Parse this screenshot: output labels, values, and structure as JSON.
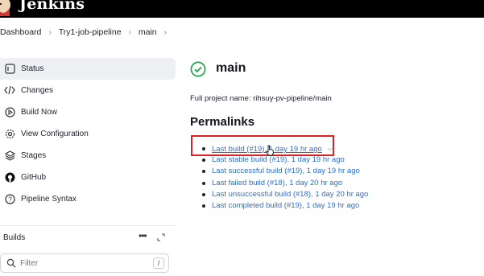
{
  "header": {
    "brand": "Jenkins"
  },
  "breadcrumb": [
    {
      "label": "Dashboard"
    },
    {
      "label": "Try1-job-pipeline"
    },
    {
      "label": "main"
    }
  ],
  "sidebar": {
    "items": [
      {
        "label": "Status",
        "icon": "status-icon",
        "active": true
      },
      {
        "label": "Changes",
        "icon": "code-icon"
      },
      {
        "label": "Build Now",
        "icon": "play-icon"
      },
      {
        "label": "View Configuration",
        "icon": "gear-icon"
      },
      {
        "label": "Stages",
        "icon": "stack-icon"
      },
      {
        "label": "GitHub",
        "icon": "github-icon"
      },
      {
        "label": "Pipeline Syntax",
        "icon": "help-icon"
      }
    ]
  },
  "builds": {
    "title": "Builds",
    "filter_placeholder": "Filter",
    "filter_shortcut": "/"
  },
  "main": {
    "title": "main",
    "full_project_name": "Full project name: rihsuy-pv-pipeline/main",
    "permalinks_title": "Permalinks",
    "permalinks": [
      {
        "label": "Last build (#19), 1 day 19 hr ago"
      },
      {
        "label": "Last stable build (#19), 1 day 19 hr ago"
      },
      {
        "label": "Last successful build (#19), 1 day 19 hr ago"
      },
      {
        "label": "Last failed build (#18), 1 day 20 hr ago"
      },
      {
        "label": "Last unsuccessful build (#18), 1 day 20 hr ago"
      },
      {
        "label": "Last completed build (#19), 1 day 19 hr ago"
      }
    ]
  },
  "colors": {
    "link": "#2a6fd6",
    "success": "#1ea446",
    "highlight": "#e02020"
  }
}
